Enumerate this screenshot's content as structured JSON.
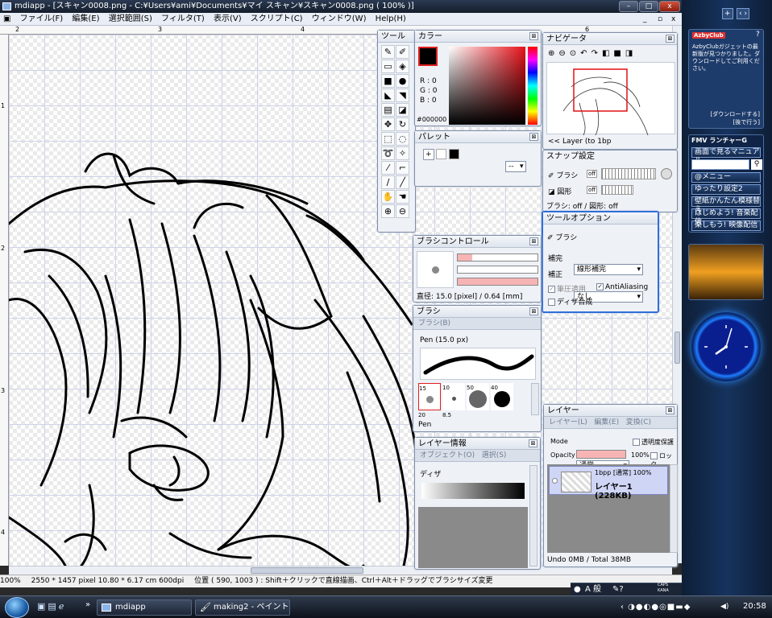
{
  "window": {
    "title": "mdiapp - [スキャン0008.png - C:¥Users¥ami¥Documents¥マイ スキャン¥スキャン0008.png ( 100% )]",
    "buttons": [
      "–",
      "□",
      "x"
    ],
    "inner_buttons": [
      "_",
      "▫",
      "x"
    ]
  },
  "menu": {
    "items": [
      "ファイル(F)",
      "編集(E)",
      "選択範囲(S)",
      "フィルタ(T)",
      "表示(V)",
      "スクリプト(C)",
      "ウィンドウ(W)",
      "Help(H)"
    ]
  },
  "ruler": {
    "top": [
      "2",
      "3",
      "4",
      "6"
    ],
    "left": [
      "1",
      "2",
      "3",
      "4"
    ]
  },
  "tool_panel": {
    "title": "ツール",
    "tools": [
      "pen-tool",
      "brush-tool",
      "eraser-tool",
      "fill-tool",
      "rect-tool",
      "ellipse-tool",
      "select-tool",
      "lasso-tool",
      "move-tool",
      "rotate-tool",
      "dropper-tool",
      "text-tool",
      "hand-tool",
      "zoom-tool"
    ]
  },
  "color_panel": {
    "title": "カラー",
    "r": "R : 0",
    "g": "G : 0",
    "b": "B : 0",
    "hex": "#000000",
    "foreground": "#000000",
    "hue": "#e8121a"
  },
  "palette_panel": {
    "title": "パレット",
    "add": "+",
    "select_value": "--"
  },
  "navigator_panel": {
    "title": "ナビゲータ",
    "status": "<< Layer (to 1bp"
  },
  "snap_panel": {
    "title": "スナップ設定",
    "brush_label": "ブラシ",
    "shape_label": "図形",
    "off": "off",
    "status": "ブラシ: off / 図形: off"
  },
  "tool_options": {
    "title": "ツールオプション",
    "tool_name": "ブラシ",
    "interp_label": "補完",
    "interp_value": "線形補完",
    "correct_label": "補正",
    "correct_value": "なし",
    "pressure": "筆圧適用",
    "antialias": "AntiAliasing",
    "dither": "ディザ合成"
  },
  "brush_control": {
    "title": "ブラシコントロール",
    "diameter": "直径: 15.0 [pixel] / 0.64 [mm]"
  },
  "brush_panel": {
    "title": "ブラシ",
    "sub": "ブラシ(B)",
    "current": "Pen (15.0 px)",
    "select_value": "--",
    "presets": [
      {
        "size": "15"
      },
      {
        "size": "10"
      },
      {
        "size": "50"
      },
      {
        "size": "40"
      },
      {
        "size": "20"
      },
      {
        "size": "8.5"
      }
    ],
    "footer": "Pen"
  },
  "layer_info": {
    "title": "レイヤー情報",
    "tabs": [
      "オブジェクト(O)",
      "選択(S)"
    ],
    "dither_label": "ディザ"
  },
  "layer_panel": {
    "title": "レイヤー",
    "tabs": [
      "レイヤー(L)",
      "編集(E)",
      "変換(C)"
    ],
    "mode_label": "Mode",
    "mode_value": "通常",
    "protect": "透明度保護",
    "opacity_label": "Opacity",
    "opacity_value": "100%",
    "lock": "ロック",
    "layer_info": "1bpp [通常] 100%",
    "layer_name": "レイヤー1 (228KB)",
    "footer": "Undo 0MB / Total 38MB"
  },
  "statusbar": {
    "zoom": "100%",
    "size": "2550 * 1457 pixel  10.80 * 6.17 cm   600dpi",
    "position": "位置 ( 590, 1003 ) : Shift＋クリックで直線描画、Ctrl＋Alt＋ドラッグでブラシサイズ変更"
  },
  "taskbar": {
    "chevron": "»",
    "tasks": [
      "mdiapp",
      "making2 - ペイント"
    ],
    "clock": "20:58",
    "ime": "A 般",
    "caps": "CAPS",
    "kana": "KANA"
  },
  "gadgets": {
    "top_buttons": [
      "+",
      "‹ ›"
    ],
    "azby_brand": "AzbyClub",
    "azby_message": "AzbyClubガジェットの最新版が見つかりました。ダウンロードしてご利用ください。",
    "azby_download": "[ダウンロードする]",
    "azby_later": "[後で行う]",
    "fmv_title": "FMV ランチャーG",
    "fmv_items": [
      "画面で見るマニュアル",
      "@メニュー",
      "ゆったり設定2",
      "壁紙かんたん模様替え",
      "はじめよう! 音楽配信",
      "楽しもう! 映像配信"
    ]
  }
}
